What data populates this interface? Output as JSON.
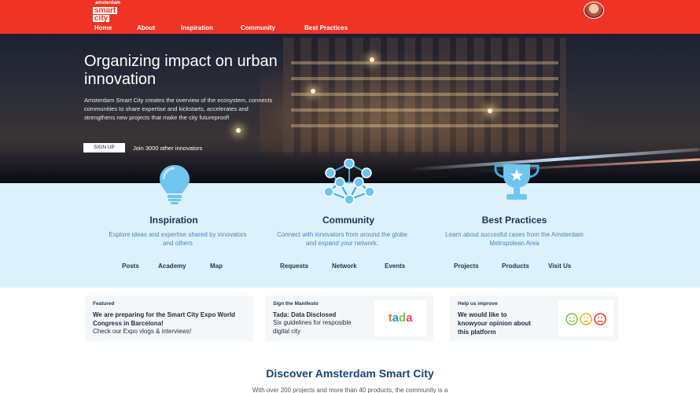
{
  "header": {
    "logo": {
      "line1": "amsterdam",
      "line2": "smart",
      "line3": "city"
    },
    "nav": [
      "Home",
      "About",
      "Inspiration",
      "Community",
      "Best Practices"
    ]
  },
  "hero": {
    "title": "Organizing impact on urban innovation",
    "description": "Amsterdam Smart City creates the overview of the ecosystem, connects communities to share expertise and kickstarts, accelerates and strengthens new projects that make the city futureproof!",
    "signup_label": "SIGN UP",
    "join_text": "Join 3000 other innovators"
  },
  "categories": [
    {
      "title": "Inspiration",
      "icon": "lightbulb-icon",
      "description": "Explore ideas and expertise shared by innovators and others",
      "links": [
        "Posts",
        "Academy",
        "Map"
      ]
    },
    {
      "title": "Community",
      "icon": "network-icon",
      "description": "Connect with innovators from around the globe and expand your network.",
      "links": [
        "Requests",
        "Network",
        "Events"
      ]
    },
    {
      "title": "Best Practices",
      "icon": "trophy-icon",
      "description": "Learn about succesful cases from the Amsterdam Metropolean Area",
      "links": [
        "Projects",
        "Products",
        "Visit Us"
      ]
    }
  ],
  "cards": [
    {
      "kicker": "Featured",
      "title": "We are preparing for the Smart City Expo World Congress in Barcelona!",
      "body": "Check our Expo vlogs & interviews!"
    },
    {
      "kicker": "Sign the Manifesto",
      "title": "Tada: Data Disclosed",
      "body": "Six guidelines  for resposible digital city",
      "image_text": "tada"
    },
    {
      "kicker": "Help us improve",
      "title": "We would like to knowyour opinion about this platform",
      "body": ""
    }
  ],
  "discover": {
    "title": "Discover Amsterdam Smart City",
    "subtitle": "With over 200 projects and more than 40 products, the community is a"
  },
  "colors": {
    "brand_red": "#ef3324",
    "band_blue": "#dcf1fb",
    "navy": "#1c3550",
    "accent_blue": "#4a86b8"
  }
}
